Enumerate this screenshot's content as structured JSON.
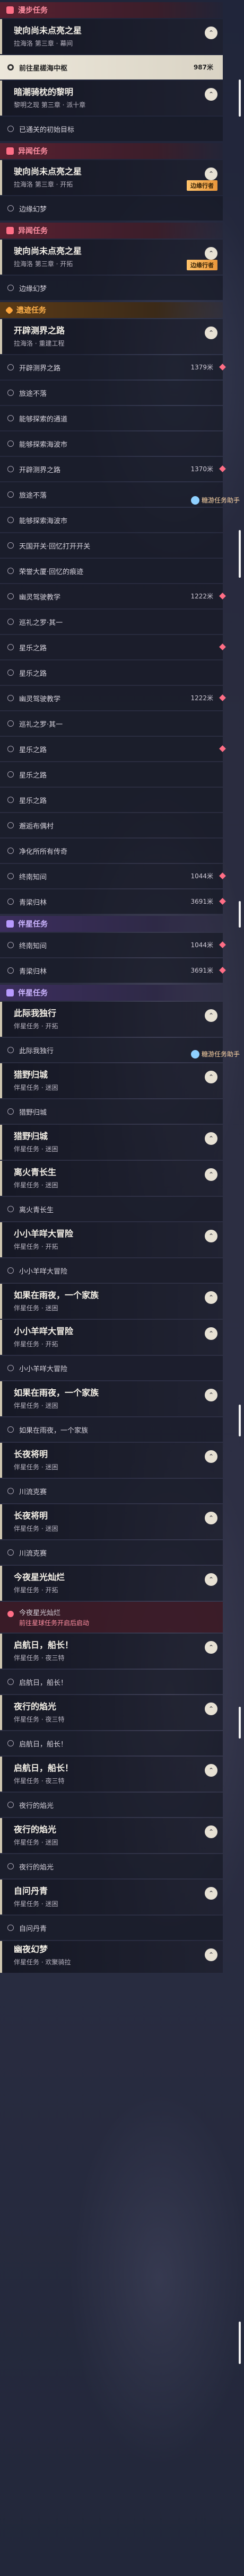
{
  "sections": [
    {
      "type": "band",
      "kind": "side",
      "text": "漫步任务"
    },
    {
      "type": "head",
      "title": "驶向尚未点亮之星",
      "sub": "拉海洛 第三章 · 幕间",
      "toggle": "⌃"
    },
    {
      "type": "row",
      "text": "前往星槎海中枢",
      "dist": "987米",
      "active": true
    },
    {
      "type": "head",
      "title": "暗潮骑枕的黎明",
      "sub": "黎明之现 第三章 · 派十章",
      "toggle": "⌃"
    },
    {
      "type": "row",
      "text": "已通关的初始目标"
    },
    {
      "type": "band",
      "kind": "side",
      "text": "异闻任务"
    },
    {
      "type": "head",
      "title": "驶向尚未点亮之星",
      "sub": "拉海洛 第三章 · 开拓",
      "toggle": "⌃",
      "tag": "边缘行者"
    },
    {
      "type": "row",
      "text": "边缘幻梦"
    },
    {
      "type": "band",
      "kind": "side",
      "text": "异闻任务"
    },
    {
      "type": "head",
      "title": "驶向尚未点亮之星",
      "sub": "拉海洛 第三章 · 开拓",
      "toggle": "⌃",
      "tag": "边缘行者"
    },
    {
      "type": "row",
      "text": "边缘幻梦"
    },
    {
      "type": "band",
      "kind": "trail",
      "text": "遗迹任务"
    },
    {
      "type": "head",
      "title": "开辟测界之路",
      "sub": "拉海洛 · 重建工程",
      "toggle": "⌃"
    },
    {
      "type": "row",
      "text": "开辟测界之路",
      "dist": "1379米",
      "pin": true
    },
    {
      "type": "row",
      "text": "旅途不落"
    },
    {
      "type": "row",
      "text": "能够探索的通道"
    },
    {
      "type": "row",
      "text": "能够探索海波市"
    },
    {
      "type": "row",
      "text": "开辟测界之路",
      "dist": "1370米",
      "pin": true
    },
    {
      "type": "row",
      "text": "旅途不落"
    },
    {
      "type": "row",
      "text": "能够探索海波市"
    },
    {
      "type": "row",
      "text": "天国开关·回忆打开开关"
    },
    {
      "type": "row",
      "text": "荣誉大厦·回忆的痕迹"
    },
    {
      "type": "row",
      "text": "幽灵驾驶教学",
      "dist": "1222米",
      "pin": true
    },
    {
      "type": "row",
      "text": "巡礼之罗·其一"
    },
    {
      "type": "row",
      "text": "星乐之路",
      "pin": true
    },
    {
      "type": "row",
      "text": "星乐之路"
    },
    {
      "type": "row",
      "text": "幽灵驾驶教学",
      "dist": "1222米",
      "pin": true
    },
    {
      "type": "row",
      "text": "巡礼之罗·其一"
    },
    {
      "type": "row",
      "text": "星乐之路",
      "pin": true
    },
    {
      "type": "row",
      "text": "星乐之路"
    },
    {
      "type": "row",
      "text": "星乐之路"
    },
    {
      "type": "row",
      "text": "邂逅布偶村"
    },
    {
      "type": "row",
      "text": "净化所所有传奇"
    },
    {
      "type": "row",
      "text": "终南知间",
      "dist": "1044米",
      "pin": true
    },
    {
      "type": "row",
      "text": "青梁归林",
      "dist": "3691米",
      "pin": true
    },
    {
      "type": "band",
      "kind": "comp",
      "text": "伴星任务"
    },
    {
      "type": "row",
      "text": "终南知间",
      "dist": "1044米",
      "pin": true
    },
    {
      "type": "row",
      "text": "青梁归林",
      "dist": "3691米",
      "pin": true
    },
    {
      "type": "band",
      "kind": "comp",
      "text": "伴星任务"
    },
    {
      "type": "head",
      "title": "此际我独行",
      "sub": "伴星任务 · 开拓",
      "toggle": "⌃"
    },
    {
      "type": "row",
      "text": "此际我独行"
    },
    {
      "type": "head",
      "title": "猎野归城",
      "sub": "伴星任务 · 迷困",
      "toggle": "⌃"
    },
    {
      "type": "row",
      "text": "猎野归城"
    },
    {
      "type": "head",
      "title": "猎野归城",
      "sub": "伴星任务 · 迷困",
      "toggle": "⌃"
    },
    {
      "type": "head",
      "title": "离火青长生",
      "sub": "伴星任务 · 迷困",
      "toggle": "⌃"
    },
    {
      "type": "row",
      "text": "离火青长生"
    },
    {
      "type": "head",
      "title": "小小羊咩大冒险",
      "sub": "伴星任务 · 开拓",
      "toggle": "⌃"
    },
    {
      "type": "row",
      "text": "小小羊咩大冒险"
    },
    {
      "type": "head",
      "title": "如果在雨夜，一个家族",
      "sub": "伴星任务 · 迷困",
      "toggle": "⌃"
    },
    {
      "type": "head",
      "title": "小小羊咩大冒险",
      "sub": "伴星任务 · 开拓",
      "toggle": "⌃"
    },
    {
      "type": "row",
      "text": "小小羊咩大冒险"
    },
    {
      "type": "head",
      "title": "如果在雨夜，一个家族",
      "sub": "伴星任务 · 迷困",
      "toggle": "⌃"
    },
    {
      "type": "row",
      "text": "如果在雨夜，一个家族"
    },
    {
      "type": "head",
      "title": "长夜将明",
      "sub": "伴星任务 · 迷困",
      "toggle": "⌃"
    },
    {
      "type": "row",
      "text": "川流克赛"
    },
    {
      "type": "head",
      "title": "长夜将明",
      "sub": "伴星任务 · 迷困",
      "toggle": "⌃"
    },
    {
      "type": "row",
      "text": "川流克赛"
    },
    {
      "type": "head",
      "title": "今夜星光灿烂",
      "sub": "伴星任务 · 开拓",
      "toggle": "⌃"
    },
    {
      "type": "warn",
      "text": "今夜星光灿烂",
      "sub": "前往星球任务开启后启动"
    },
    {
      "type": "head",
      "title": "启航日，船长！",
      "sub": "伴星任务 · 夜三特",
      "toggle": "⌃"
    },
    {
      "type": "row",
      "text": "启航日，船长！"
    },
    {
      "type": "head",
      "title": "夜行的焰光",
      "sub": "伴星任务 · 夜三特",
      "toggle": "⌃"
    },
    {
      "type": "row",
      "text": "启航日，船长！"
    },
    {
      "type": "head",
      "title": "启航日，船长！",
      "sub": "伴星任务 · 夜三特",
      "toggle": "⌃"
    },
    {
      "type": "row",
      "text": "夜行的焰光"
    },
    {
      "type": "head",
      "title": "夜行的焰光",
      "sub": "伴星任务 · 迷困",
      "toggle": "⌃"
    },
    {
      "type": "row",
      "text": "夜行的焰光"
    },
    {
      "type": "head",
      "title": "自问丹青",
      "sub": "伴星任务 · 迷困",
      "toggle": "⌃"
    },
    {
      "type": "row",
      "text": "自问丹青"
    },
    {
      "type": "head",
      "title": "幽夜幻梦",
      "sub": "伴星任务 · 欢聚骑拉",
      "toggle": "⌃",
      "cut": true
    }
  ],
  "watermark": {
    "text": "糖游任务助手",
    "icon": "game-logo-icon"
  },
  "colors": {
    "side": "#ff6e86",
    "trail": "#ffa63c",
    "companion": "#b89aff",
    "active": "#ece7da"
  }
}
